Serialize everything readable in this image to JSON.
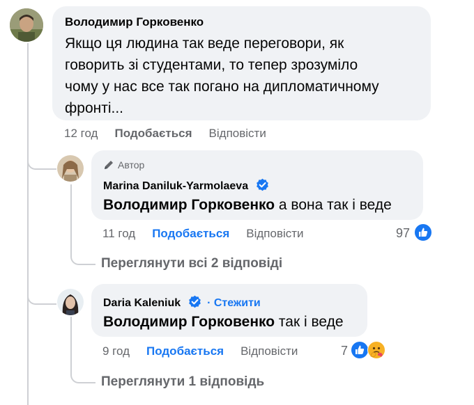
{
  "comment1": {
    "author": "Володимир Горковенко",
    "text": "Якщо ця людина так веде переговори, як говорить зі студентами, то тепер зрозуміло чому у нас все так погано на дипломатичному фронті...",
    "lines": [
      "Якщо ця людина так веде переговори, як",
      "говорить зі студентами, то тепер зрозуміло",
      "чому у нас все так погано на дипломатичному",
      "фронті..."
    ],
    "time": "12 год",
    "like_label": "Подобається",
    "reply_label": "Відповісти"
  },
  "reply1": {
    "author_badge": "Автор",
    "author": "Marina Daniluk-Yarmolaeva",
    "mention": "Володимир Горковенко",
    "text": " а вона так і веде",
    "time": "11 год",
    "like_label": "Подобається",
    "reply_label": "Відповісти",
    "reaction_count": "97",
    "view_replies": "Переглянути всі 2 відповіді"
  },
  "reply2": {
    "author": "Daria Kaleniuk",
    "follow_label": "· Стежити",
    "mention": "Володимир Горковенко",
    "text": " так і веде",
    "time": "9 год",
    "like_label": "Подобається",
    "reply_label": "Відповісти",
    "reaction_count": "7",
    "view_replies": "Переглянути 1 відповідь"
  },
  "colors": {
    "accent": "#1877f2",
    "bubble": "#f0f2f5",
    "secondary_text": "#65676b",
    "thread_line": "#ced0d4"
  },
  "icons": {
    "verified": "verified-badge-icon",
    "pencil": "pencil-icon",
    "like": "like-reaction-icon",
    "care": "care-reaction-icon"
  }
}
